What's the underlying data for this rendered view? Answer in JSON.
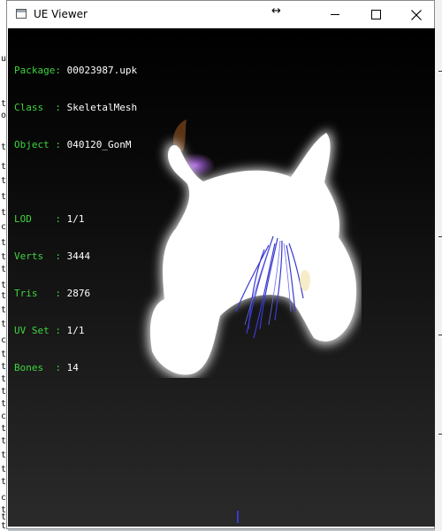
{
  "background_console": {
    "chars": [
      "u",
      "t",
      "o",
      "t",
      "t",
      "t",
      "t",
      "t",
      "c",
      "t",
      "t",
      "t",
      "t",
      "t",
      "t",
      "t",
      "c",
      "t",
      "t",
      "t",
      "t",
      "t",
      "c",
      "t",
      "t",
      "t",
      "t",
      "t",
      "c",
      "t",
      "t",
      "t"
    ]
  },
  "window": {
    "title": "UE Viewer",
    "icon": "window-icon",
    "controls": {
      "minimize": "minimize-icon",
      "maximize": "maximize-icon",
      "close": "close-icon",
      "resize": "resize-horizontal-icon"
    }
  },
  "info": {
    "package_label": "Package:",
    "package_value": "00023987.upk",
    "class_label": "Class  :",
    "class_value": "SkeletalMesh",
    "object_label": "Object :",
    "object_value": "040120_GonM",
    "lod_label": "LOD    :",
    "lod_value": "1/1",
    "verts_label": "Verts  :",
    "verts_value": "3444",
    "tris_label": "Tris   :",
    "tris_value": "2876",
    "uvset_label": "UV Set :",
    "uvset_value": "1/1",
    "bones_label": "Bones  :",
    "bones_value": "14"
  },
  "colors": {
    "label_green": "#3fd43f",
    "value_white": "#ffffff",
    "viewport_top": "#000000",
    "viewport_bottom": "#2a2a2a",
    "hair_blue": "#3a3ad0"
  }
}
